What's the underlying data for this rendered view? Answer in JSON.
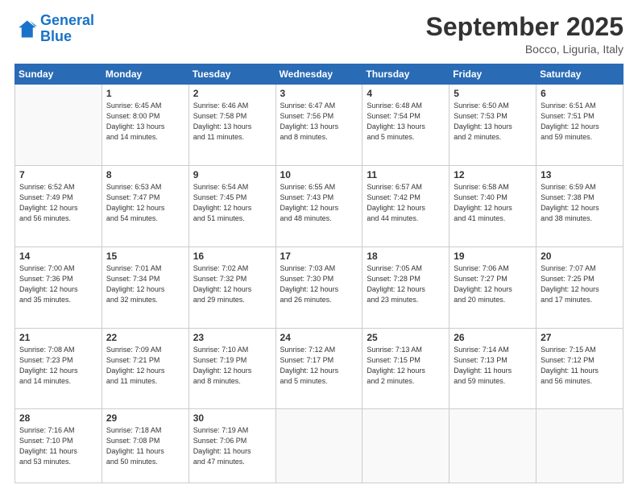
{
  "logo": {
    "line1": "General",
    "line2": "Blue"
  },
  "header": {
    "title": "September 2025",
    "location": "Bocco, Liguria, Italy"
  },
  "weekdays": [
    "Sunday",
    "Monday",
    "Tuesday",
    "Wednesday",
    "Thursday",
    "Friday",
    "Saturday"
  ],
  "weeks": [
    [
      {
        "day": "",
        "info": ""
      },
      {
        "day": "1",
        "info": "Sunrise: 6:45 AM\nSunset: 8:00 PM\nDaylight: 13 hours\nand 14 minutes."
      },
      {
        "day": "2",
        "info": "Sunrise: 6:46 AM\nSunset: 7:58 PM\nDaylight: 13 hours\nand 11 minutes."
      },
      {
        "day": "3",
        "info": "Sunrise: 6:47 AM\nSunset: 7:56 PM\nDaylight: 13 hours\nand 8 minutes."
      },
      {
        "day": "4",
        "info": "Sunrise: 6:48 AM\nSunset: 7:54 PM\nDaylight: 13 hours\nand 5 minutes."
      },
      {
        "day": "5",
        "info": "Sunrise: 6:50 AM\nSunset: 7:53 PM\nDaylight: 13 hours\nand 2 minutes."
      },
      {
        "day": "6",
        "info": "Sunrise: 6:51 AM\nSunset: 7:51 PM\nDaylight: 12 hours\nand 59 minutes."
      }
    ],
    [
      {
        "day": "7",
        "info": "Sunrise: 6:52 AM\nSunset: 7:49 PM\nDaylight: 12 hours\nand 56 minutes."
      },
      {
        "day": "8",
        "info": "Sunrise: 6:53 AM\nSunset: 7:47 PM\nDaylight: 12 hours\nand 54 minutes."
      },
      {
        "day": "9",
        "info": "Sunrise: 6:54 AM\nSunset: 7:45 PM\nDaylight: 12 hours\nand 51 minutes."
      },
      {
        "day": "10",
        "info": "Sunrise: 6:55 AM\nSunset: 7:43 PM\nDaylight: 12 hours\nand 48 minutes."
      },
      {
        "day": "11",
        "info": "Sunrise: 6:57 AM\nSunset: 7:42 PM\nDaylight: 12 hours\nand 44 minutes."
      },
      {
        "day": "12",
        "info": "Sunrise: 6:58 AM\nSunset: 7:40 PM\nDaylight: 12 hours\nand 41 minutes."
      },
      {
        "day": "13",
        "info": "Sunrise: 6:59 AM\nSunset: 7:38 PM\nDaylight: 12 hours\nand 38 minutes."
      }
    ],
    [
      {
        "day": "14",
        "info": "Sunrise: 7:00 AM\nSunset: 7:36 PM\nDaylight: 12 hours\nand 35 minutes."
      },
      {
        "day": "15",
        "info": "Sunrise: 7:01 AM\nSunset: 7:34 PM\nDaylight: 12 hours\nand 32 minutes."
      },
      {
        "day": "16",
        "info": "Sunrise: 7:02 AM\nSunset: 7:32 PM\nDaylight: 12 hours\nand 29 minutes."
      },
      {
        "day": "17",
        "info": "Sunrise: 7:03 AM\nSunset: 7:30 PM\nDaylight: 12 hours\nand 26 minutes."
      },
      {
        "day": "18",
        "info": "Sunrise: 7:05 AM\nSunset: 7:28 PM\nDaylight: 12 hours\nand 23 minutes."
      },
      {
        "day": "19",
        "info": "Sunrise: 7:06 AM\nSunset: 7:27 PM\nDaylight: 12 hours\nand 20 minutes."
      },
      {
        "day": "20",
        "info": "Sunrise: 7:07 AM\nSunset: 7:25 PM\nDaylight: 12 hours\nand 17 minutes."
      }
    ],
    [
      {
        "day": "21",
        "info": "Sunrise: 7:08 AM\nSunset: 7:23 PM\nDaylight: 12 hours\nand 14 minutes."
      },
      {
        "day": "22",
        "info": "Sunrise: 7:09 AM\nSunset: 7:21 PM\nDaylight: 12 hours\nand 11 minutes."
      },
      {
        "day": "23",
        "info": "Sunrise: 7:10 AM\nSunset: 7:19 PM\nDaylight: 12 hours\nand 8 minutes."
      },
      {
        "day": "24",
        "info": "Sunrise: 7:12 AM\nSunset: 7:17 PM\nDaylight: 12 hours\nand 5 minutes."
      },
      {
        "day": "25",
        "info": "Sunrise: 7:13 AM\nSunset: 7:15 PM\nDaylight: 12 hours\nand 2 minutes."
      },
      {
        "day": "26",
        "info": "Sunrise: 7:14 AM\nSunset: 7:13 PM\nDaylight: 11 hours\nand 59 minutes."
      },
      {
        "day": "27",
        "info": "Sunrise: 7:15 AM\nSunset: 7:12 PM\nDaylight: 11 hours\nand 56 minutes."
      }
    ],
    [
      {
        "day": "28",
        "info": "Sunrise: 7:16 AM\nSunset: 7:10 PM\nDaylight: 11 hours\nand 53 minutes."
      },
      {
        "day": "29",
        "info": "Sunrise: 7:18 AM\nSunset: 7:08 PM\nDaylight: 11 hours\nand 50 minutes."
      },
      {
        "day": "30",
        "info": "Sunrise: 7:19 AM\nSunset: 7:06 PM\nDaylight: 11 hours\nand 47 minutes."
      },
      {
        "day": "",
        "info": ""
      },
      {
        "day": "",
        "info": ""
      },
      {
        "day": "",
        "info": ""
      },
      {
        "day": "",
        "info": ""
      }
    ]
  ]
}
